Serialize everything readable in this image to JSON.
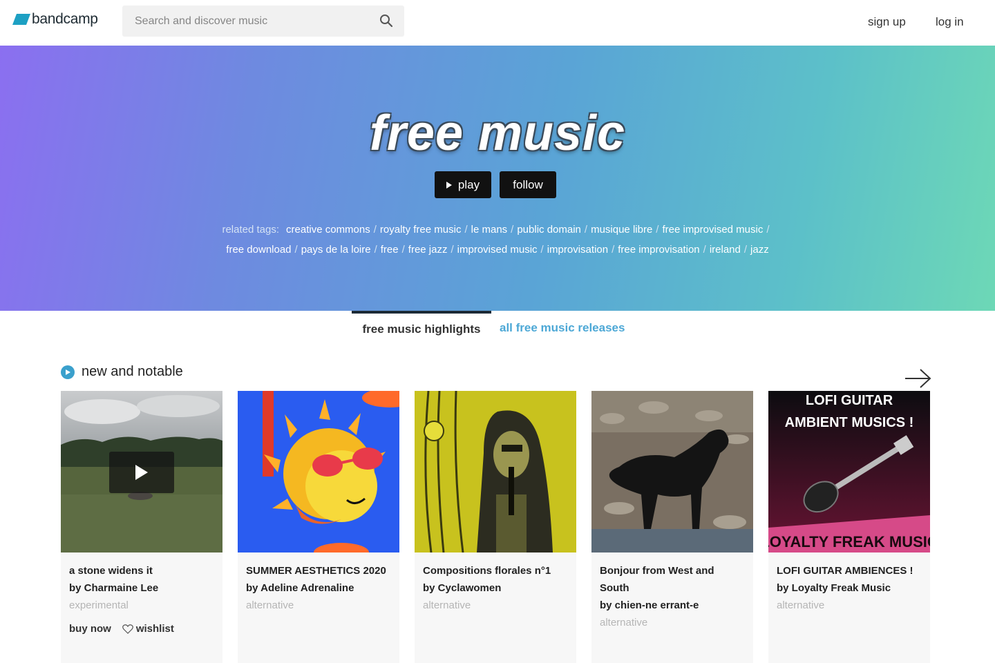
{
  "header": {
    "logo_text": "bandcamp",
    "search_placeholder": "Search and discover music",
    "signup_label": "sign up",
    "login_label": "log in"
  },
  "hero": {
    "title": "free music",
    "play_label": "play",
    "follow_label": "follow",
    "related_label": "related tags:",
    "tags": [
      "creative commons",
      "royalty free music",
      "le mans",
      "public domain",
      "musique libre",
      "free improvised music",
      "free download",
      "pays de la loire",
      "free",
      "free jazz",
      "improvised music",
      "improvisation",
      "free improvisation",
      "ireland",
      "jazz"
    ]
  },
  "tabs": {
    "highlights": "free music highlights",
    "releases": "all free music releases"
  },
  "section": {
    "title": "new and notable"
  },
  "cards": [
    {
      "title": "a stone widens it",
      "artist": "by Charmaine Lee",
      "genre": "experimental",
      "buy_label": "buy now",
      "wishlist_label": "wishlist"
    },
    {
      "title": "SUMMER AESTHETICS 2020",
      "artist": "by Adeline Adrenaline",
      "genre": "alternative"
    },
    {
      "title": "Compositions florales n°1",
      "artist": "by Cyclawomen",
      "genre": "alternative"
    },
    {
      "title": "Bonjour from West and South",
      "artist": "by chien-ne errant-e",
      "genre": "alternative"
    },
    {
      "title": "LOFI GUITAR AMBIENCES !",
      "artist": "by Loyalty Freak Music",
      "genre": "alternative"
    }
  ],
  "artwork_text": {
    "lofi_line1": "LOFI GUITAR",
    "lofi_line2": "AMBIENT MUSICS !",
    "lofi_bottom": "LOYALTY FREAK MUSIC"
  }
}
